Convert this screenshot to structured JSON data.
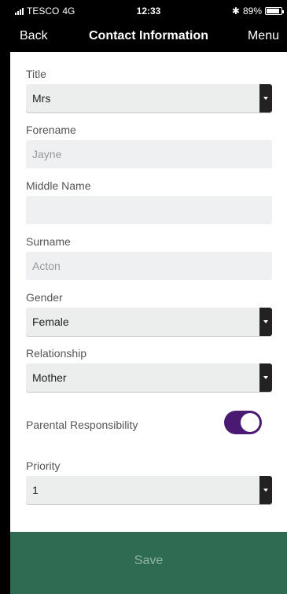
{
  "status_bar": {
    "carrier": "TESCO",
    "network": "4G",
    "time": "12:33",
    "battery_percent": "89%",
    "battery_level": 0.89,
    "bluetooth_icon": "bluetooth-icon"
  },
  "nav": {
    "back_label": "Back",
    "title": "Contact Information",
    "menu_label": "Menu"
  },
  "form": {
    "title": {
      "label": "Title",
      "value": "Mrs"
    },
    "forename": {
      "label": "Forename",
      "value": "Jayne"
    },
    "middle_name": {
      "label": "Middle Name",
      "value": ""
    },
    "surname": {
      "label": "Surname",
      "value": "Acton"
    },
    "gender": {
      "label": "Gender",
      "value": "Female"
    },
    "relationship": {
      "label": "Relationship",
      "value": "Mother"
    },
    "parental_responsibility": {
      "label": "Parental Responsibility",
      "enabled": true
    },
    "priority": {
      "label": "Priority",
      "value": "1"
    }
  },
  "footer": {
    "save_label": "Save"
  },
  "colors": {
    "toggle_on": "#4a1a73",
    "footer_bg": "#2f6b52",
    "save_text": "#8fb3a3"
  }
}
